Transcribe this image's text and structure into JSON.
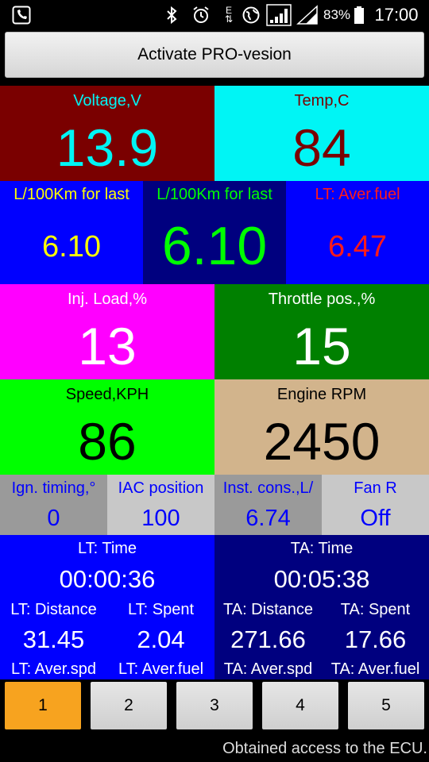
{
  "status_bar": {
    "battery_percent": "83%",
    "time": "17:00",
    "network_letter": "E",
    "icons": [
      "phone-icon",
      "bluetooth-icon",
      "alarm-icon",
      "data-e-icon",
      "globe-icon",
      "signal-icon",
      "signal2-icon",
      "battery-icon"
    ]
  },
  "activate_button": "Activate PRO-vesion",
  "gauges": {
    "voltage": {
      "label": "Voltage,V",
      "value": "13.9"
    },
    "temp": {
      "label": "Temp,C",
      "value": "84"
    },
    "fuel_left": {
      "label": "L/100Km for last",
      "value": "6.10"
    },
    "fuel_mid": {
      "label": "L/100Km for last",
      "value": "6.10"
    },
    "lt_aver_fuel_top": {
      "label": "LT: Aver.fuel",
      "value": "6.47"
    },
    "inj_load": {
      "label": "Inj. Load,%",
      "value": "13"
    },
    "throttle": {
      "label": "Throttle pos.,%",
      "value": "15"
    },
    "speed": {
      "label": "Speed,KPH",
      "value": "86"
    },
    "rpm": {
      "label": "Engine RPM",
      "value": "2450"
    },
    "ign_timing": {
      "label": "Ign. timing,°",
      "value": "0"
    },
    "iac": {
      "label": "IAC position",
      "value": "100"
    },
    "inst_cons": {
      "label": "Inst. cons.,L/",
      "value": "6.74"
    },
    "fan": {
      "label": "Fan R",
      "value": "Off"
    }
  },
  "trip": {
    "lt_time": {
      "label": "LT: Time",
      "value": "00:00:36"
    },
    "ta_time": {
      "label": "TA: Time",
      "value": "00:05:38"
    },
    "lt_distance": {
      "label": "LT: Distance",
      "value": "31.45"
    },
    "lt_spent": {
      "label": "LT: Spent",
      "value": "2.04"
    },
    "ta_distance": {
      "label": "TA: Distance",
      "value": "271.66"
    },
    "ta_spent": {
      "label": "TA: Spent",
      "value": "17.66"
    },
    "lt_aver_spd": {
      "label": "LT: Aver.spd"
    },
    "lt_aver_fuel": {
      "label": "LT: Aver.fuel"
    },
    "ta_aver_spd": {
      "label": "TA: Aver.spd"
    },
    "ta_aver_fuel": {
      "label": "TA: Aver.fuel"
    }
  },
  "tabs": [
    "1",
    "2",
    "3",
    "4",
    "5"
  ],
  "active_tab": "1",
  "footer_status": "Obtained access to the ECU.",
  "colors": {
    "maroon": "#7a0000",
    "cyan": "#00f5f5",
    "blue": "#0000ff",
    "navy": "#00007f",
    "magenta": "#ff00ff",
    "green": "#008000",
    "lime": "#00ff00",
    "tan": "#d2b48c",
    "gray": "#9a9a9a",
    "silver": "#c8c8c8",
    "orange": "#f7a31f"
  }
}
